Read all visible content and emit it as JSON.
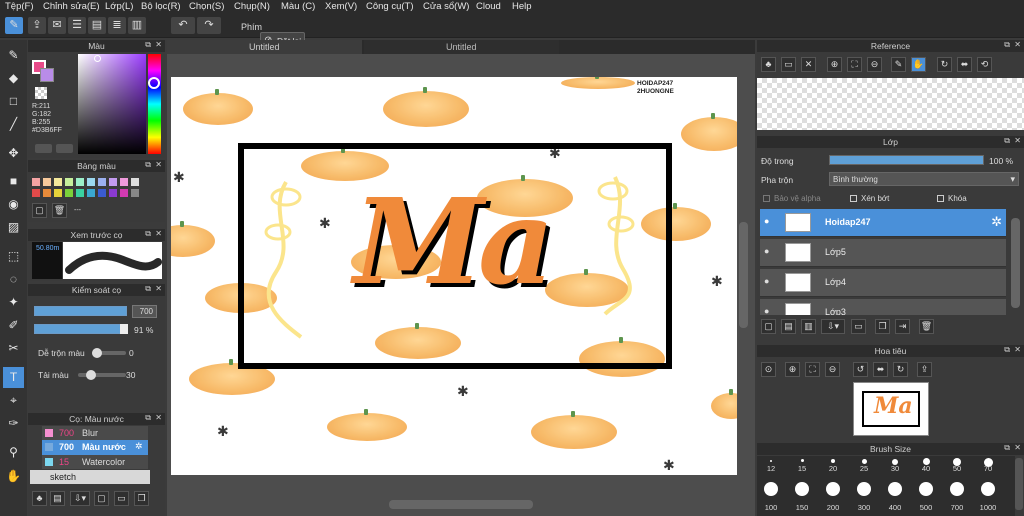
{
  "menu": [
    "Tệp(F)",
    "Chỉnh sửa(E)",
    "Lớp(L)",
    "Bộ lọc(R)",
    "Chọn(S)",
    "Chụp(N)",
    "Màu (C)",
    "Xem(V)",
    "Công cụ(T)",
    "Cửa sổ(W)",
    "Cloud",
    "Help"
  ],
  "toolbar": {
    "phim_label": "Phím",
    "reset_label": "Đặt lại"
  },
  "color_panel": {
    "title": "Màu",
    "r": "R:211",
    "g": "G:182",
    "b": "B:255",
    "hex": "#D3B6FF",
    "fg_color": "#e84b8a",
    "bg_color": "#b98ce8"
  },
  "palette_panel": {
    "title": "Bảng màu",
    "extra": "---"
  },
  "preview_panel": {
    "title": "Xem trước cọ",
    "size": "50.80m"
  },
  "brush_control": {
    "title": "Kiểm soát cọ",
    "size_value": "700",
    "opacity_value": "91 %",
    "blend_label": "Dễ trộn màu",
    "blend_value": "0",
    "reload_label": "Tải màu",
    "reload_value": "30"
  },
  "brush_list": {
    "title": "Cọ: Màu nước",
    "items": [
      {
        "size": "700",
        "name": "Blur"
      },
      {
        "size": "700",
        "name": "Màu nước"
      },
      {
        "size": "15",
        "name": "Watercolor"
      }
    ],
    "group": "sketch"
  },
  "tabs": [
    "Untitled",
    "Untitled"
  ],
  "canvas": {
    "title_text": "Ma",
    "watermark1": "HOIDAP247",
    "watermark2": "2HUONGNE"
  },
  "reference": {
    "title": "Reference"
  },
  "layers": {
    "title": "Lớp",
    "opacity_label": "Độ trong",
    "opacity_value": "100 %",
    "opacity_fraction": 1.0,
    "blend_label": "Pha trộn",
    "blend_value": "Bình thường",
    "protect_alpha": "Bảo vệ alpha",
    "clipping": "Xén bớt",
    "lock": "Khóa",
    "items": [
      {
        "name": "Hoidap247"
      },
      {
        "name": "Lớp5"
      },
      {
        "name": "Lớp4"
      },
      {
        "name": "Lớp3"
      }
    ]
  },
  "navigator": {
    "title": "Hoa tiêu"
  },
  "brush_size": {
    "title": "Brush Size",
    "row1": [
      "12",
      "15",
      "20",
      "25",
      "30",
      "40",
      "50",
      "70"
    ],
    "row2": [
      "100",
      "150",
      "200",
      "300",
      "400",
      "500",
      "700",
      "1000"
    ]
  }
}
